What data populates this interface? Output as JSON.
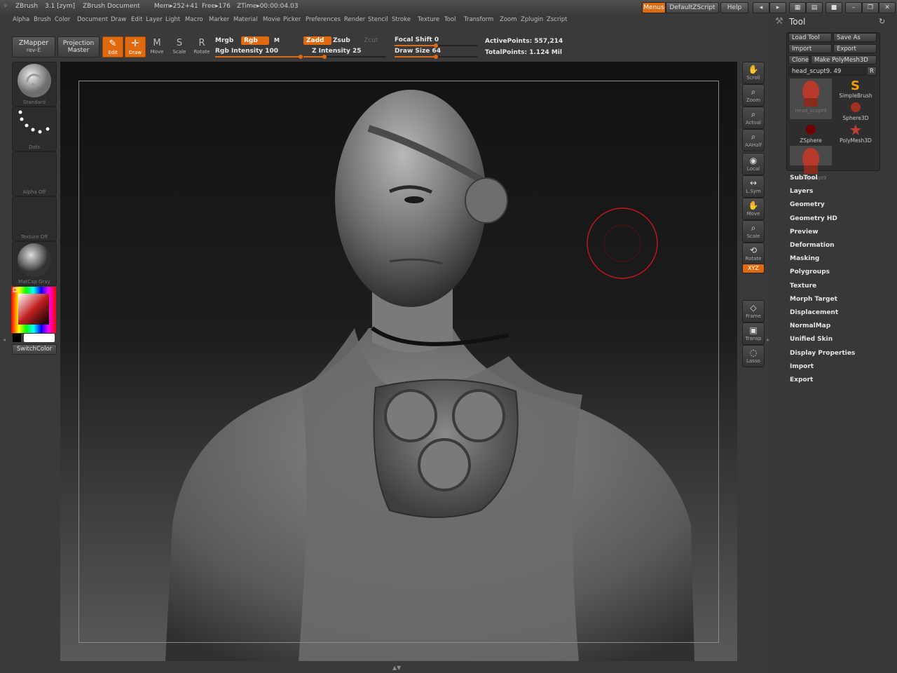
{
  "titlebar": {
    "app": "ZBrush",
    "version": "3.1 [zym]",
    "document": "ZBrush Document",
    "mem": "Mem▸252+41",
    "free": "Free▸176",
    "ztime": "ZTime▸00:00:04.03",
    "menus_btn": "Menus",
    "script_btn": "DefaultZScript",
    "help_btn": "Help"
  },
  "menubar": [
    "Alpha",
    "Brush",
    "Color",
    "Document",
    "Draw",
    "Edit",
    "Layer",
    "Light",
    "Macro",
    "Marker",
    "Material",
    "Movie",
    "Picker",
    "Preferences",
    "Render",
    "Stencil",
    "Stroke",
    "Texture",
    "Tool",
    "Transform",
    "Zoom",
    "Zplugin",
    "Zscript"
  ],
  "shelf": {
    "zmapper": "ZMapper",
    "zmapper_sub": "rev-E",
    "projection": "Projection",
    "projection_sub": "Master",
    "tools": [
      {
        "label": "Edit",
        "glyph": "✎",
        "active": true
      },
      {
        "label": "Draw",
        "glyph": "✛",
        "active": true
      },
      {
        "label": "Move",
        "glyph": "M",
        "active": false
      },
      {
        "label": "Scale",
        "glyph": "S",
        "active": false
      },
      {
        "label": "Rotate",
        "glyph": "R",
        "active": false
      }
    ],
    "mrgb": "Mrgb",
    "rgb": "Rgb",
    "m": "M",
    "rgb_intensity": "Rgb Intensity 100",
    "zadd": "Zadd",
    "zsub": "Zsub",
    "zcut": "Zcut",
    "z_intensity": "Z Intensity 25",
    "focal_shift": "Focal Shift 0",
    "draw_size": "Draw Size 64",
    "active_points": "ActivePoints: 557,214",
    "total_points": "TotalPoints: 1.124 Mil",
    "rgb_intensity_value": 100,
    "z_intensity_value": 25,
    "focal_shift_value": 0,
    "draw_size_value": 64
  },
  "leftshelf": {
    "brush": "Standard",
    "stroke": "Dots",
    "alpha": "Alpha Off",
    "texture": "Texture Off",
    "material": "MatCap Gray",
    "switchcolor": "SwitchColor"
  },
  "rightshelf": [
    {
      "label": "Scroll",
      "icon": "hand-icon"
    },
    {
      "label": "Zoom",
      "icon": "magnifier-icon"
    },
    {
      "label": "Actual",
      "icon": "magnifier-icon"
    },
    {
      "label": "AAHalf",
      "icon": "magnifier-icon"
    },
    {
      "label": "Local",
      "icon": "local-icon"
    },
    {
      "label": "L.Sym",
      "icon": "symmetry-icon"
    },
    {
      "label": "Move",
      "icon": "hand-icon"
    },
    {
      "label": "Scale",
      "icon": "magnifier-icon"
    },
    {
      "label": "Rotate",
      "icon": "rotate-icon"
    },
    {
      "label": "XYZ",
      "icon": "xyz-icon"
    },
    {
      "label": "Frame",
      "icon": "cube-icon"
    },
    {
      "label": "Transp",
      "icon": "transp-icon"
    },
    {
      "label": "Lasso",
      "icon": "lasso-icon"
    }
  ],
  "toolpanel": {
    "title": "Tool",
    "load_tool": "Load Tool",
    "save_as": "Save As",
    "import": "Import",
    "export": "Export",
    "clone": "Clone",
    "make_polymesh": "Make PolyMesh3D",
    "current_tool": "head_scupt9. 49",
    "r_btn": "R",
    "thumbs": [
      {
        "label": "head_scupt9",
        "kind": "head"
      },
      {
        "label": "SimpleBrush",
        "kind": "brush"
      },
      {
        "label": "Sphere3D",
        "kind": "sphere"
      },
      {
        "label": "ZSphere",
        "kind": "zsphere"
      },
      {
        "label": "PolyMesh3D",
        "kind": "star"
      },
      {
        "label": "head_scupt9",
        "kind": "head"
      }
    ],
    "menus": [
      "SubTool",
      "Layers",
      "Geometry",
      "Geometry HD",
      "Preview",
      "Deformation",
      "Masking",
      "Polygroups",
      "Texture",
      "Morph Target",
      "Displacement",
      "NormalMap",
      "Unified Skin",
      "Display Properties",
      "Import",
      "Export"
    ]
  },
  "colors": {
    "accent": "#e06a10",
    "brush_ring": "#c01818"
  }
}
